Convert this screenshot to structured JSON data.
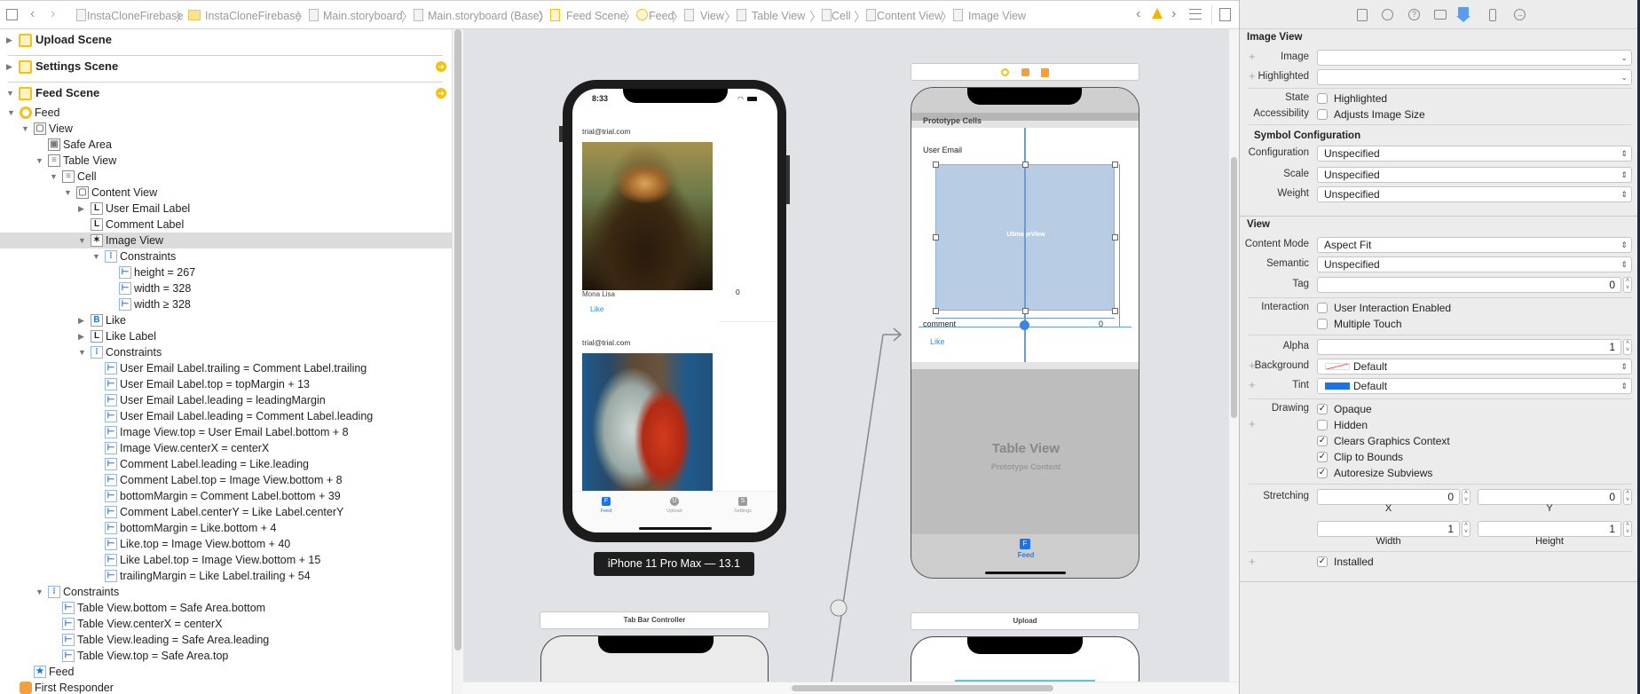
{
  "toolbar": {
    "breadcrumbs": [
      "InstaCloneFirebase",
      "InstaCloneFirebase",
      "Main.storyboard",
      "Main.storyboard (Base)",
      "Feed Scene",
      "Feed",
      "View",
      "Table View",
      "Cell",
      "Content View",
      "Image View"
    ],
    "warning_icon": "warning-triangle-icon",
    "warning_color": "#f5b400"
  },
  "outline": {
    "scenes": [
      {
        "label": "Upload Scene",
        "expanded": false,
        "has_arrow": false
      },
      {
        "label": "Settings Scene",
        "expanded": false,
        "has_arrow": true
      },
      {
        "label": "Feed Scene",
        "expanded": true,
        "has_arrow": true
      }
    ],
    "items": [
      {
        "level": 1,
        "label": "Feed",
        "icon": "view-controller",
        "tri": "open"
      },
      {
        "level": 2,
        "label": "View",
        "icon": "view",
        "tri": "open"
      },
      {
        "level": 3,
        "label": "Safe Area",
        "icon": "safe-area",
        "tri": ""
      },
      {
        "level": 3,
        "label": "Table View",
        "icon": "table-view",
        "tri": "open"
      },
      {
        "level": 4,
        "label": "Cell",
        "icon": "cell",
        "tri": "open"
      },
      {
        "level": 5,
        "label": "Content View",
        "icon": "view",
        "tri": "open"
      },
      {
        "level": 6,
        "label": "User Email Label",
        "icon": "label",
        "tri": "closed"
      },
      {
        "level": 6,
        "label": "Comment Label",
        "icon": "label",
        "tri": ""
      },
      {
        "level": 6,
        "label": "Image View",
        "icon": "image-view",
        "tri": "open",
        "selected": true
      },
      {
        "level": 7,
        "label": "Constraints",
        "icon": "constraints",
        "tri": "open"
      },
      {
        "level": 8,
        "label": "height = 267",
        "icon": "constraint",
        "tri": ""
      },
      {
        "level": 8,
        "label": "width = 328",
        "icon": "constraint",
        "tri": ""
      },
      {
        "level": 8,
        "label": "width ≥ 328",
        "icon": "constraint",
        "tri": ""
      },
      {
        "level": 6,
        "label": "Like",
        "icon": "button",
        "tri": "closed"
      },
      {
        "level": 6,
        "label": "Like Label",
        "icon": "label",
        "tri": "closed"
      },
      {
        "level": 6,
        "label": "Constraints",
        "icon": "constraints",
        "tri": "open"
      },
      {
        "level": 7,
        "label": "User Email Label.trailing = Comment Label.trailing",
        "icon": "constraint",
        "tri": ""
      },
      {
        "level": 7,
        "label": "User Email Label.top = topMargin + 13",
        "icon": "constraint",
        "tri": ""
      },
      {
        "level": 7,
        "label": "User Email Label.leading = leadingMargin",
        "icon": "constraint",
        "tri": ""
      },
      {
        "level": 7,
        "label": "User Email Label.leading = Comment Label.leading",
        "icon": "constraint",
        "tri": ""
      },
      {
        "level": 7,
        "label": "Image View.top = User Email Label.bottom + 8",
        "icon": "constraint",
        "tri": ""
      },
      {
        "level": 7,
        "label": "Image View.centerX = centerX",
        "icon": "constraint",
        "tri": ""
      },
      {
        "level": 7,
        "label": "Comment Label.leading = Like.leading",
        "icon": "constraint",
        "tri": ""
      },
      {
        "level": 7,
        "label": "Comment Label.top = Image View.bottom + 8",
        "icon": "constraint",
        "tri": ""
      },
      {
        "level": 7,
        "label": "bottomMargin = Comment Label.bottom + 39",
        "icon": "constraint",
        "tri": ""
      },
      {
        "level": 7,
        "label": "Comment Label.centerY = Like Label.centerY",
        "icon": "constraint",
        "tri": ""
      },
      {
        "level": 7,
        "label": "bottomMargin = Like.bottom + 4",
        "icon": "constraint",
        "tri": ""
      },
      {
        "level": 7,
        "label": "Like.top = Image View.bottom + 40",
        "icon": "constraint",
        "tri": ""
      },
      {
        "level": 7,
        "label": "Like Label.top = Image View.bottom + 15",
        "icon": "constraint",
        "tri": ""
      },
      {
        "level": 7,
        "label": "trailingMargin = Like Label.trailing + 54",
        "icon": "constraint",
        "tri": ""
      },
      {
        "level": 3,
        "label": "Constraints",
        "icon": "constraints",
        "tri": "open"
      },
      {
        "level": 4,
        "label": "Table View.bottom = Safe Area.bottom",
        "icon": "constraint",
        "tri": ""
      },
      {
        "level": 4,
        "label": "Table View.centerX = centerX",
        "icon": "constraint",
        "tri": ""
      },
      {
        "level": 4,
        "label": "Table View.leading = Safe Area.leading",
        "icon": "constraint",
        "tri": ""
      },
      {
        "level": 4,
        "label": "Table View.top = Safe Area.top",
        "icon": "constraint",
        "tri": ""
      },
      {
        "level": 2,
        "label": "Feed",
        "icon": "tab-bar-item",
        "tri": ""
      },
      {
        "level": 1,
        "label": "First Responder",
        "icon": "first-responder",
        "tri": ""
      }
    ]
  },
  "canvas": {
    "device": {
      "time": "8:33",
      "posts": [
        {
          "email": "trial@trial.com",
          "comment": "Mona Lisa",
          "likes": "0",
          "like": "Like"
        },
        {
          "email": "trial@trial.com"
        }
      ],
      "tabs": [
        "Feed",
        "Upload",
        "Settings"
      ],
      "tab_letters": [
        "F",
        "U",
        "S"
      ],
      "device_label": "iPhone 11 Pro Max — 13.1"
    },
    "scene": {
      "section": "Prototype Cells",
      "user_email": "User Email",
      "image_view": "UIImageView",
      "comment": "comment",
      "likes": "0",
      "like": "Like",
      "table_title": "Table View",
      "table_subtitle": "Prototype Content",
      "tab": "Feed",
      "tab_letter": "F"
    },
    "tab_bar_controller_title": "Tab Bar Controller",
    "upload_title": "Upload"
  },
  "inspector": {
    "image_view": {
      "title": "Image View",
      "image_label": "Image",
      "image_value": "",
      "highlighted_label": "Highlighted",
      "highlighted_value": "",
      "state_label": "State",
      "state_option": "Highlighted",
      "state_checked": false,
      "accessibility_label": "Accessibility",
      "accessibility_option": "Adjusts Image Size",
      "accessibility_checked": false
    },
    "symbol": {
      "title": "Symbol Configuration",
      "configuration_label": "Configuration",
      "configuration_value": "Unspecified",
      "scale_label": "Scale",
      "scale_value": "Unspecified",
      "weight_label": "Weight",
      "weight_value": "Unspecified"
    },
    "view": {
      "title": "View",
      "content_mode_label": "Content Mode",
      "content_mode_value": "Aspect Fit",
      "semantic_label": "Semantic",
      "semantic_value": "Unspecified",
      "tag_label": "Tag",
      "tag_value": "0",
      "interaction_label": "Interaction",
      "user_interaction": "User Interaction Enabled",
      "user_interaction_checked": false,
      "multiple_touch": "Multiple Touch",
      "multiple_touch_checked": false,
      "alpha_label": "Alpha",
      "alpha_value": "1",
      "background_label": "Background",
      "background_value": "Default",
      "tint_label": "Tint",
      "tint_value": "Default",
      "tint_color": "#1a73e8",
      "drawing_label": "Drawing",
      "opaque": "Opaque",
      "opaque_checked": true,
      "hidden": "Hidden",
      "hidden_checked": false,
      "clears": "Clears Graphics Context",
      "clears_checked": true,
      "clip": "Clip to Bounds",
      "clip_checked": true,
      "autoresize": "Autoresize Subviews",
      "autoresize_checked": true,
      "stretching_label": "Stretching",
      "stretch_x": "0",
      "stretch_y": "0",
      "stretch_w": "1",
      "stretch_h": "1",
      "x_label": "X",
      "y_label": "Y",
      "width_label": "Width",
      "height_label": "Height",
      "installed": "Installed",
      "installed_checked": true
    }
  }
}
